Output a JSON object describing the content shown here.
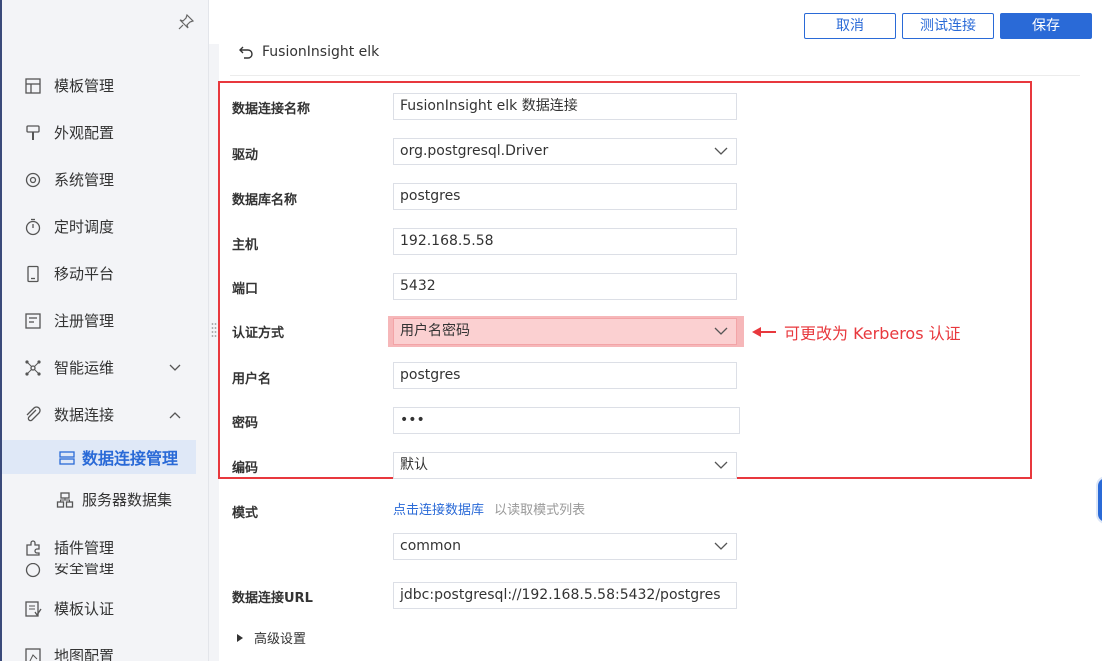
{
  "sidebar": {
    "items": [
      {
        "label": "模板管理",
        "icon": "template-icon"
      },
      {
        "label": "外观配置",
        "icon": "brush-icon"
      },
      {
        "label": "系统管理",
        "icon": "gear-icon"
      },
      {
        "label": "定时调度",
        "icon": "timer-icon"
      },
      {
        "label": "移动平台",
        "icon": "mobile-icon"
      },
      {
        "label": "注册管理",
        "icon": "register-icon"
      },
      {
        "label": "智能运维",
        "icon": "ops-icon"
      },
      {
        "label": "数据连接",
        "icon": "link-icon"
      },
      {
        "label": "数据连接管理",
        "icon": "db-connection-icon"
      },
      {
        "label": "服务器数据集",
        "icon": "server-dataset-icon"
      },
      {
        "label": "插件管理",
        "icon": "plugin-icon"
      },
      {
        "label": "安全管理",
        "icon": "shield-icon"
      },
      {
        "label": "模板认证",
        "icon": "cert-icon"
      },
      {
        "label": "地图配置",
        "icon": "map-icon"
      }
    ]
  },
  "toolbar": {
    "cancel_label": "取消",
    "test_label": "测试连接",
    "save_label": "保存"
  },
  "header": {
    "title": "FusionInsight elk"
  },
  "form": {
    "conn_name": {
      "label": "数据连接名称",
      "value": "FusionInsight elk 数据连接"
    },
    "driver": {
      "label": "驱动",
      "value": "org.postgresql.Driver"
    },
    "db_name": {
      "label": "数据库名称",
      "value": "postgres"
    },
    "host": {
      "label": "主机",
      "value": "192.168.5.58"
    },
    "port": {
      "label": "端口",
      "value": "5432"
    },
    "auth": {
      "label": "认证方式",
      "value": "用户名密码"
    },
    "username": {
      "label": "用户名",
      "value": "postgres"
    },
    "password": {
      "label": "密码",
      "value": "•••"
    },
    "encoding": {
      "label": "编码",
      "value": "默认"
    },
    "schema": {
      "label": "模式",
      "link": "点击连接数据库",
      "hint": "以读取模式列表",
      "value": "common"
    },
    "url": {
      "label": "数据连接URL",
      "value": "jdbc:postgresql://192.168.5.58:5432/postgres"
    },
    "advanced_label": "高级设置"
  },
  "annotation": {
    "text": "可更改为 Kerberos 认证"
  },
  "colors": {
    "accent": "#2a6ad7",
    "highlight_red": "#e8383d",
    "auth_highlight": "#f6b7b9"
  }
}
